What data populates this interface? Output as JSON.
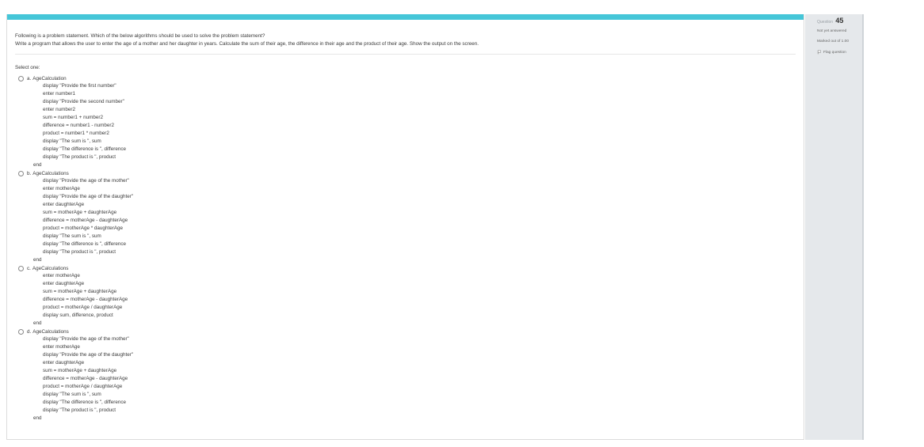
{
  "info": {
    "question_label": "Question",
    "question_number": "45",
    "state": "Not yet answered",
    "grade": "Marked out of 1.00",
    "flag": "Flag question"
  },
  "question": {
    "line1": "Following is a problem statement.  Which of the below algorithms should be used to solve the problem statement?",
    "line2": "Write a program that allows the user to enter the age of a mother and her daughter in years.  Calculate the sum of their age, the difference in their age and the product of their age.  Show the output on the screen.",
    "select_one": "Select one:"
  },
  "options": [
    {
      "letter": "a.",
      "title": "AgeCalculation",
      "lines": [
        "display \"Provide the first number\"",
        "enter number1",
        "display \"Provide the second number\"",
        "enter number2",
        "sum = number1 + number2",
        "difference = number1 - number2",
        "product = number1 * number2",
        "display \"The sum is \", sum",
        "display \"The difference is \", difference",
        "display \"The product is \", product"
      ],
      "end": "end"
    },
    {
      "letter": "b.",
      "title": "AgeCalculations",
      "lines": [
        "display \"Provide the age of the mother\"",
        "enter motherAge",
        "display \"Provide the age of the daughter\"",
        "enter daughterAge",
        "sum = motherAge + daughterAge",
        "difference = motherAge - daughterAge",
        "product = motherAge * daughterAge",
        "display \"The sum is \", sum",
        "display \"The difference is \", difference",
        "display \"The product is \", product"
      ],
      "end": "end"
    },
    {
      "letter": "c.",
      "title": "AgeCalculations",
      "lines": [
        "enter motherAge",
        "enter daughterAge",
        "sum = motherAge + daughterAge",
        "difference = motherAge - daughterAge",
        "product = motherAge / daughterAge",
        "display sum, difference, product"
      ],
      "end": "end"
    },
    {
      "letter": "d.",
      "title": "AgeCalculations",
      "lines": [
        "display \"Provide the age of the mother\"",
        "enter motherAge",
        "display \"Provide the age of the daughter\"",
        "enter daughterAge",
        "sum = motherAge + daughterAge",
        "difference = motherAge - daughterAge",
        "product = motherAge / daughterAge",
        "display \"The sum is \", sum",
        "display \"The difference is \", difference",
        "display \"The product is \", product"
      ],
      "end": "end"
    }
  ],
  "colors": {
    "accent_bar": "#45c6d8",
    "info_panel": "#e5e8eb"
  }
}
